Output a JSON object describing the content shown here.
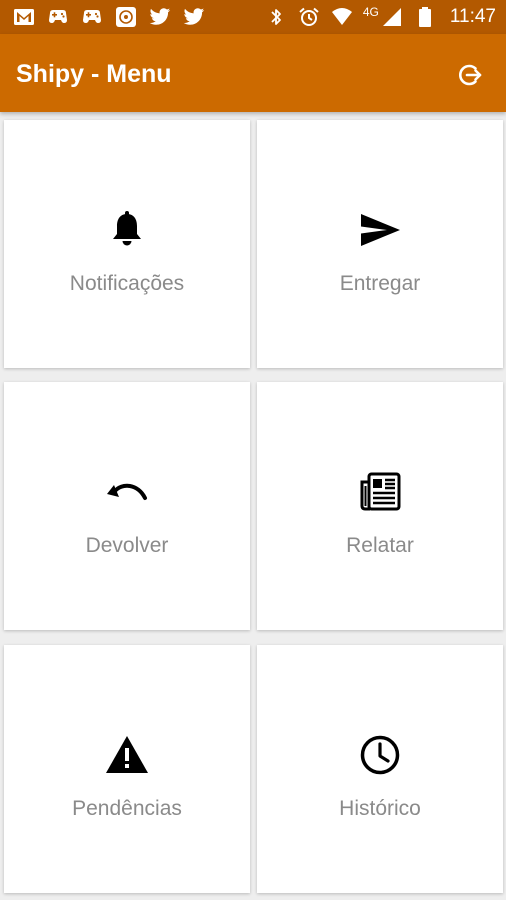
{
  "status_bar": {
    "network": "4G",
    "time": "11:47"
  },
  "app_bar": {
    "title": "Shipy - Menu",
    "logout_icon": "logout-icon"
  },
  "menu": {
    "items": [
      {
        "label": "Notificações",
        "icon": "bell-icon"
      },
      {
        "label": "Entregar",
        "icon": "send-icon"
      },
      {
        "label": "Devolver",
        "icon": "undo-icon"
      },
      {
        "label": "Relatar",
        "icon": "newspaper-icon"
      },
      {
        "label": "Pendências",
        "icon": "warning-icon"
      },
      {
        "label": "Histórico",
        "icon": "clock-icon"
      }
    ]
  },
  "colors": {
    "status_bar": "#b35900",
    "app_bar": "#cc6a00",
    "background": "#eeeeee",
    "tile": "#ffffff",
    "label_text": "#8a8a8a"
  }
}
